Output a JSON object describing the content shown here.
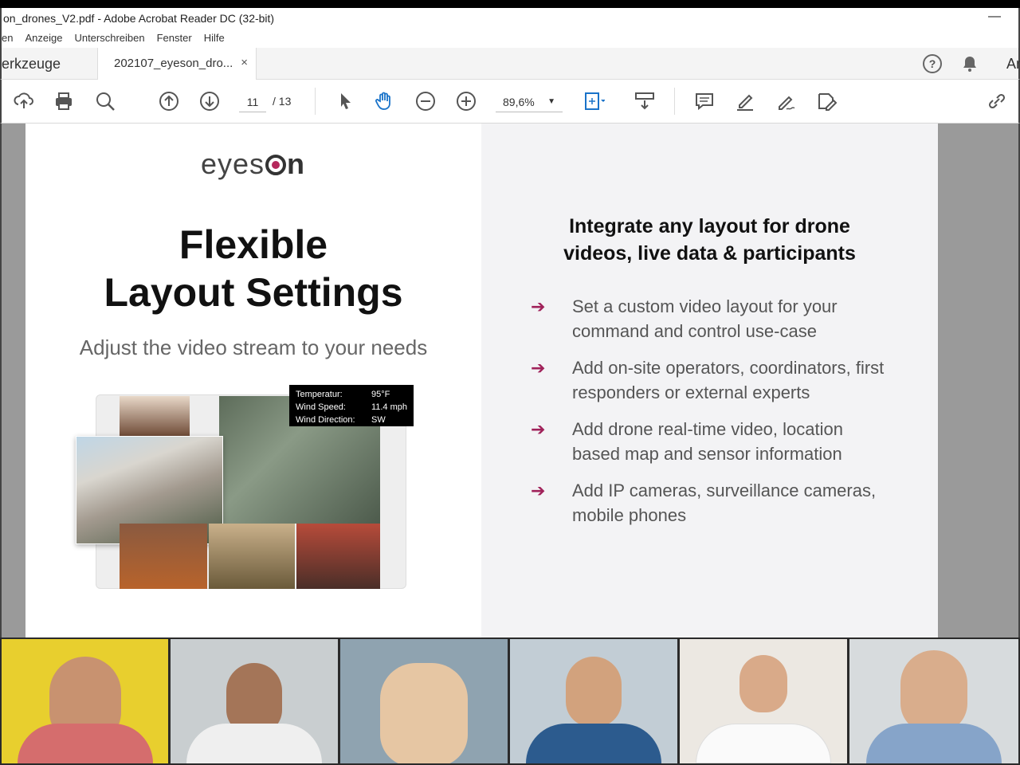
{
  "window": {
    "title": "on_drones_V2.pdf - Adobe Acrobat Reader DC (32-bit)",
    "minimize_glyph": "—"
  },
  "menu": {
    "items": [
      "en",
      "Anzeige",
      "Unterschreiben",
      "Fenster",
      "Hilfe"
    ]
  },
  "tabs": {
    "tools_label": "erkzeuge",
    "doc_label": "202107_eyeson_dro...",
    "close_glyph": "×",
    "right_label": "Ar"
  },
  "toolbar": {
    "current_page": "11",
    "total_pages": "/ 13",
    "zoom": "89,6%",
    "icons": [
      "upload-icon",
      "print-icon",
      "search-icon",
      "page-up-icon",
      "page-down-icon",
      "select-arrow-icon",
      "hand-icon",
      "zoom-out-icon",
      "zoom-in-icon",
      "fit-page-icon",
      "scroll-mode-icon",
      "comment-icon",
      "highlight-icon",
      "sign-icon",
      "edit-icon",
      "share-link-icon"
    ]
  },
  "slide": {
    "logo_left": "eyes",
    "logo_right": "n",
    "headline_line1": "Flexible",
    "headline_line2": "Layout Settings",
    "subline": "Adjust the video stream to your needs",
    "info_box": [
      {
        "k": "Temperatur:",
        "v": "95°F"
      },
      {
        "k": "Wind Speed:",
        "v": "11.4 mph"
      },
      {
        "k": "Wind Direction:",
        "v": "SW"
      }
    ],
    "right_title_line1": "Integrate any layout for drone",
    "right_title_line2": "videos, live data & participants",
    "bullet_arrow": "➔",
    "bullets": [
      "Set a custom video layout for your command and control use-case",
      "Add on-site operators, coordinators, first responders or external experts",
      "Add drone real-time video, location based map and sensor information",
      "Add IP cameras, surveillance cameras, mobile phones"
    ]
  },
  "colors": {
    "accent": "#a0225a",
    "toolbar_blue": "#1a73c9"
  }
}
